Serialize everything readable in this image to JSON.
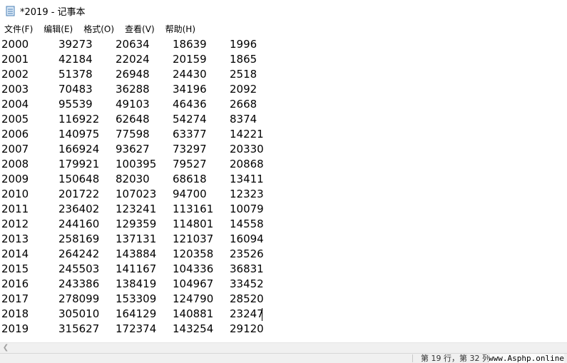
{
  "window": {
    "title": "*2019 - 记事本"
  },
  "menu": {
    "items": [
      "文件(F)",
      "编辑(E)",
      "格式(O)",
      "查看(V)",
      "帮助(H)"
    ]
  },
  "editor": {
    "rows": [
      [
        "2000",
        "39273",
        "20634",
        "18639",
        "1996"
      ],
      [
        "2001",
        "42184",
        "22024",
        "20159",
        "1865"
      ],
      [
        "2002",
        "51378",
        "26948",
        "24430",
        "2518"
      ],
      [
        "2003",
        "70483",
        "36288",
        "34196",
        "2092"
      ],
      [
        "2004",
        "95539",
        "49103",
        "46436",
        "2668"
      ],
      [
        "2005",
        "116922",
        "62648",
        "54274",
        "8374"
      ],
      [
        "2006",
        "140975",
        "77598",
        "63377",
        "14221"
      ],
      [
        "2007",
        "166924",
        "93627",
        "73297",
        "20330"
      ],
      [
        "2008",
        "179921",
        "100395",
        "79527",
        "20868"
      ],
      [
        "2009",
        "150648",
        "82030",
        "68618",
        "13411"
      ],
      [
        "2010",
        "201722",
        "107023",
        "94700",
        "12323"
      ],
      [
        "2011",
        "236402",
        "123241",
        "113161",
        "10079"
      ],
      [
        "2012",
        "244160",
        "129359",
        "114801",
        "14558"
      ],
      [
        "2013",
        "258169",
        "137131",
        "121037",
        "16094"
      ],
      [
        "2014",
        "264242",
        "143884",
        "120358",
        "23526"
      ],
      [
        "2015",
        "245503",
        "141167",
        "104336",
        "36831"
      ],
      [
        "2016",
        "243386",
        "138419",
        "104967",
        "33452"
      ],
      [
        "2017",
        "278099",
        "153309",
        "124790",
        "28520"
      ],
      [
        "2018",
        "305010",
        "164129",
        "140881",
        "23247"
      ],
      [
        "2019",
        "315627",
        "172374",
        "143254",
        "29120"
      ]
    ]
  },
  "statusbar": {
    "position": "第 19 行，第 32 列",
    "watermark": "www.Asphp.online"
  }
}
